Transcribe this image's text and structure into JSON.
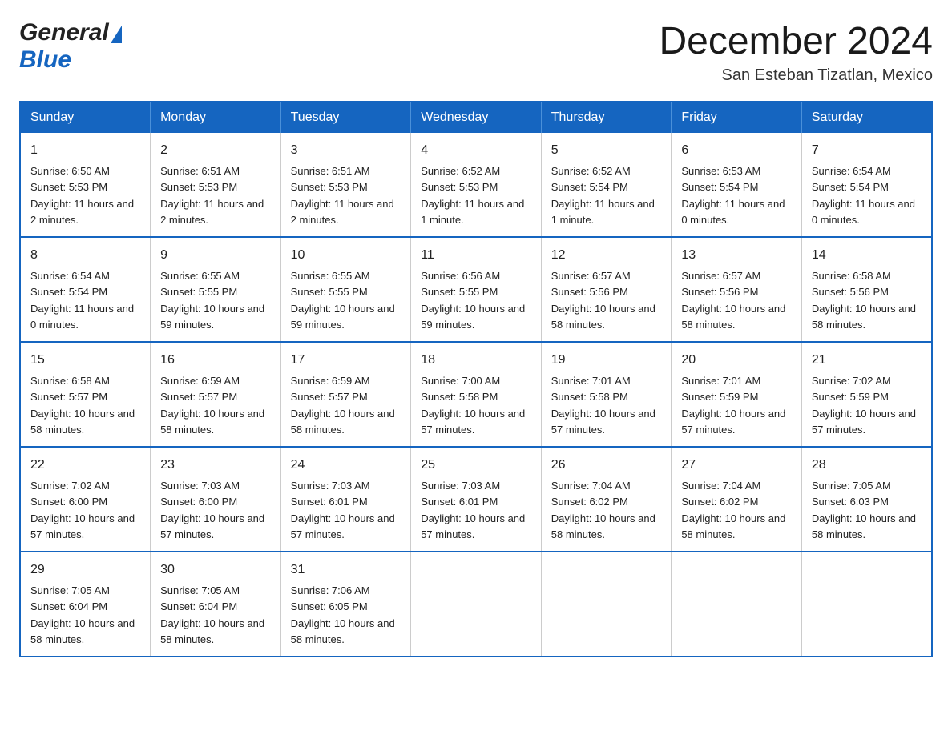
{
  "header": {
    "logo_general": "General",
    "logo_blue": "Blue",
    "month_title": "December 2024",
    "location": "San Esteban Tizatlan, Mexico"
  },
  "days_of_week": [
    "Sunday",
    "Monday",
    "Tuesday",
    "Wednesday",
    "Thursday",
    "Friday",
    "Saturday"
  ],
  "weeks": [
    [
      {
        "day": "1",
        "sunrise": "6:50 AM",
        "sunset": "5:53 PM",
        "daylight": "11 hours and 2 minutes."
      },
      {
        "day": "2",
        "sunrise": "6:51 AM",
        "sunset": "5:53 PM",
        "daylight": "11 hours and 2 minutes."
      },
      {
        "day": "3",
        "sunrise": "6:51 AM",
        "sunset": "5:53 PM",
        "daylight": "11 hours and 2 minutes."
      },
      {
        "day": "4",
        "sunrise": "6:52 AM",
        "sunset": "5:53 PM",
        "daylight": "11 hours and 1 minute."
      },
      {
        "day": "5",
        "sunrise": "6:52 AM",
        "sunset": "5:54 PM",
        "daylight": "11 hours and 1 minute."
      },
      {
        "day": "6",
        "sunrise": "6:53 AM",
        "sunset": "5:54 PM",
        "daylight": "11 hours and 0 minutes."
      },
      {
        "day": "7",
        "sunrise": "6:54 AM",
        "sunset": "5:54 PM",
        "daylight": "11 hours and 0 minutes."
      }
    ],
    [
      {
        "day": "8",
        "sunrise": "6:54 AM",
        "sunset": "5:54 PM",
        "daylight": "11 hours and 0 minutes."
      },
      {
        "day": "9",
        "sunrise": "6:55 AM",
        "sunset": "5:55 PM",
        "daylight": "10 hours and 59 minutes."
      },
      {
        "day": "10",
        "sunrise": "6:55 AM",
        "sunset": "5:55 PM",
        "daylight": "10 hours and 59 minutes."
      },
      {
        "day": "11",
        "sunrise": "6:56 AM",
        "sunset": "5:55 PM",
        "daylight": "10 hours and 59 minutes."
      },
      {
        "day": "12",
        "sunrise": "6:57 AM",
        "sunset": "5:56 PM",
        "daylight": "10 hours and 58 minutes."
      },
      {
        "day": "13",
        "sunrise": "6:57 AM",
        "sunset": "5:56 PM",
        "daylight": "10 hours and 58 minutes."
      },
      {
        "day": "14",
        "sunrise": "6:58 AM",
        "sunset": "5:56 PM",
        "daylight": "10 hours and 58 minutes."
      }
    ],
    [
      {
        "day": "15",
        "sunrise": "6:58 AM",
        "sunset": "5:57 PM",
        "daylight": "10 hours and 58 minutes."
      },
      {
        "day": "16",
        "sunrise": "6:59 AM",
        "sunset": "5:57 PM",
        "daylight": "10 hours and 58 minutes."
      },
      {
        "day": "17",
        "sunrise": "6:59 AM",
        "sunset": "5:57 PM",
        "daylight": "10 hours and 58 minutes."
      },
      {
        "day": "18",
        "sunrise": "7:00 AM",
        "sunset": "5:58 PM",
        "daylight": "10 hours and 57 minutes."
      },
      {
        "day": "19",
        "sunrise": "7:01 AM",
        "sunset": "5:58 PM",
        "daylight": "10 hours and 57 minutes."
      },
      {
        "day": "20",
        "sunrise": "7:01 AM",
        "sunset": "5:59 PM",
        "daylight": "10 hours and 57 minutes."
      },
      {
        "day": "21",
        "sunrise": "7:02 AM",
        "sunset": "5:59 PM",
        "daylight": "10 hours and 57 minutes."
      }
    ],
    [
      {
        "day": "22",
        "sunrise": "7:02 AM",
        "sunset": "6:00 PM",
        "daylight": "10 hours and 57 minutes."
      },
      {
        "day": "23",
        "sunrise": "7:03 AM",
        "sunset": "6:00 PM",
        "daylight": "10 hours and 57 minutes."
      },
      {
        "day": "24",
        "sunrise": "7:03 AM",
        "sunset": "6:01 PM",
        "daylight": "10 hours and 57 minutes."
      },
      {
        "day": "25",
        "sunrise": "7:03 AM",
        "sunset": "6:01 PM",
        "daylight": "10 hours and 57 minutes."
      },
      {
        "day": "26",
        "sunrise": "7:04 AM",
        "sunset": "6:02 PM",
        "daylight": "10 hours and 58 minutes."
      },
      {
        "day": "27",
        "sunrise": "7:04 AM",
        "sunset": "6:02 PM",
        "daylight": "10 hours and 58 minutes."
      },
      {
        "day": "28",
        "sunrise": "7:05 AM",
        "sunset": "6:03 PM",
        "daylight": "10 hours and 58 minutes."
      }
    ],
    [
      {
        "day": "29",
        "sunrise": "7:05 AM",
        "sunset": "6:04 PM",
        "daylight": "10 hours and 58 minutes."
      },
      {
        "day": "30",
        "sunrise": "7:05 AM",
        "sunset": "6:04 PM",
        "daylight": "10 hours and 58 minutes."
      },
      {
        "day": "31",
        "sunrise": "7:06 AM",
        "sunset": "6:05 PM",
        "daylight": "10 hours and 58 minutes."
      },
      null,
      null,
      null,
      null
    ]
  ]
}
